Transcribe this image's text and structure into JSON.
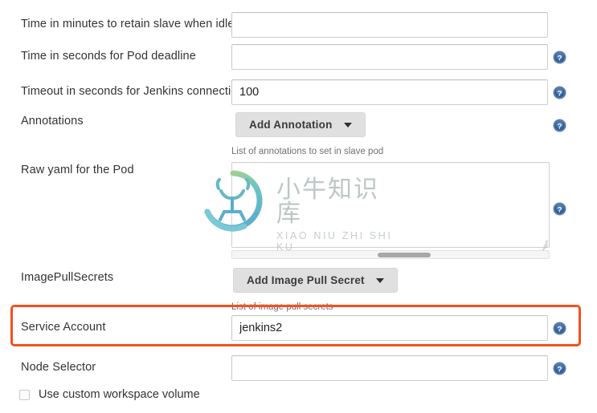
{
  "form": {
    "rows": [
      {
        "label": "Time in minutes to retain slave when idle",
        "value": "",
        "placeholder": "",
        "has_help": false
      },
      {
        "label": "Time in seconds for Pod deadline",
        "value": "",
        "placeholder": "",
        "has_help": true
      },
      {
        "label": "Timeout in seconds for Jenkins connection",
        "value": "100",
        "placeholder": "",
        "has_help": true
      }
    ],
    "annotations": {
      "label": "Annotations",
      "button_label": "Add Annotation",
      "hint": "List of annotations to set in slave pod",
      "help_icon": "help-circle-icon"
    },
    "raw_yaml": {
      "label": "Raw yaml for the Pod",
      "value": "",
      "placeholder": "",
      "help_icon": "help-circle-icon"
    },
    "image_pull_secrets": {
      "label": "ImagePullSecrets",
      "button_label": "Add Image Pull Secret",
      "hint": "List of image pull secrets"
    },
    "service_account": {
      "label": "Service Account",
      "value": "jenkins2",
      "placeholder": "",
      "help_icon": "help-circle-icon"
    },
    "node_selector": {
      "label": "Node Selector",
      "value": "",
      "placeholder": "",
      "help_icon": "help-circle-icon"
    },
    "custom_workspace": {
      "label": "Use custom workspace volume",
      "checked": false
    }
  },
  "watermark": {
    "text_cn": "小牛知识库",
    "text_en": "XIAO NIU ZHI SHI KU"
  },
  "highlight": {
    "color": "#f4511e"
  },
  "colors": {
    "highlight": "#f4511e",
    "help_icon": "#4a6fa5",
    "button_bg": "#e0e0e0",
    "text": "#333333",
    "hint_text": "#707070"
  }
}
